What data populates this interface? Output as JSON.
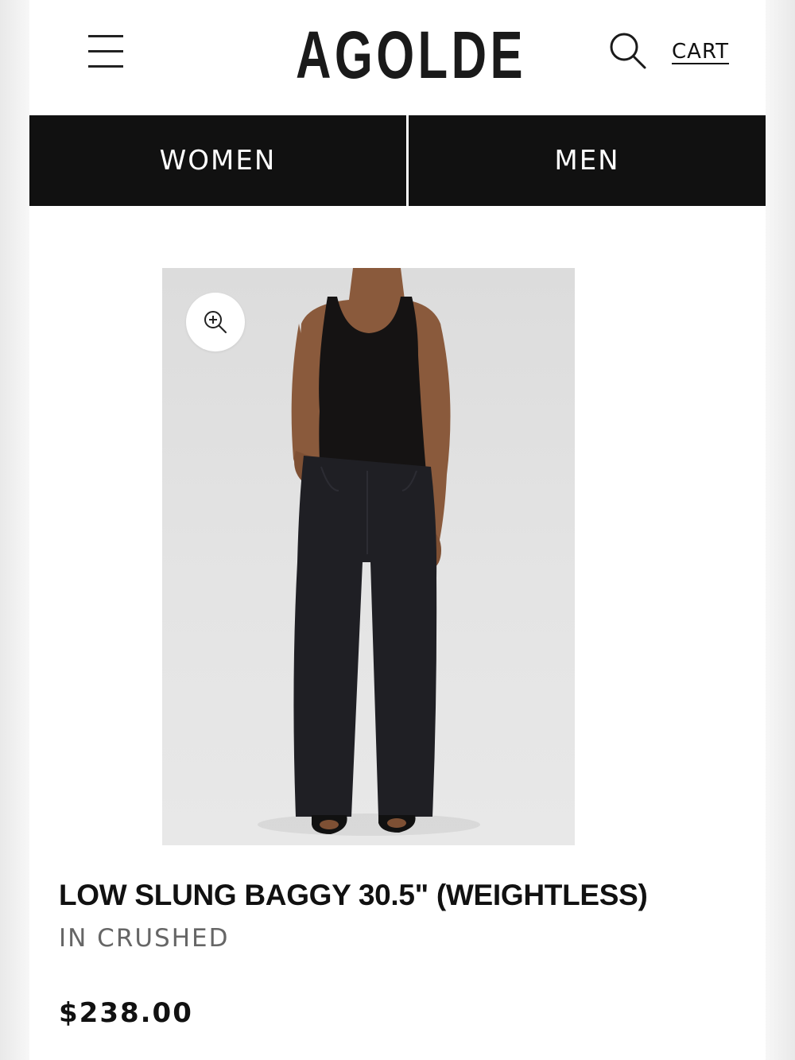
{
  "header": {
    "logo_text": "AGOLDE",
    "cart_label": "CART"
  },
  "nav": {
    "tabs": [
      {
        "label": "WOMEN"
      },
      {
        "label": "MEN"
      }
    ]
  },
  "product": {
    "title": "LOW SLUNG BAGGY 30.5\" (WEIGHTLESS)",
    "color_line": "IN CRUSHED",
    "price": "$238.00",
    "image_icon": "zoom-in-icon"
  },
  "colors": {
    "nav_background": "#111111",
    "nav_text": "#ffffff",
    "image_background": "#e0e0e0",
    "subtitle_text": "#666666"
  }
}
